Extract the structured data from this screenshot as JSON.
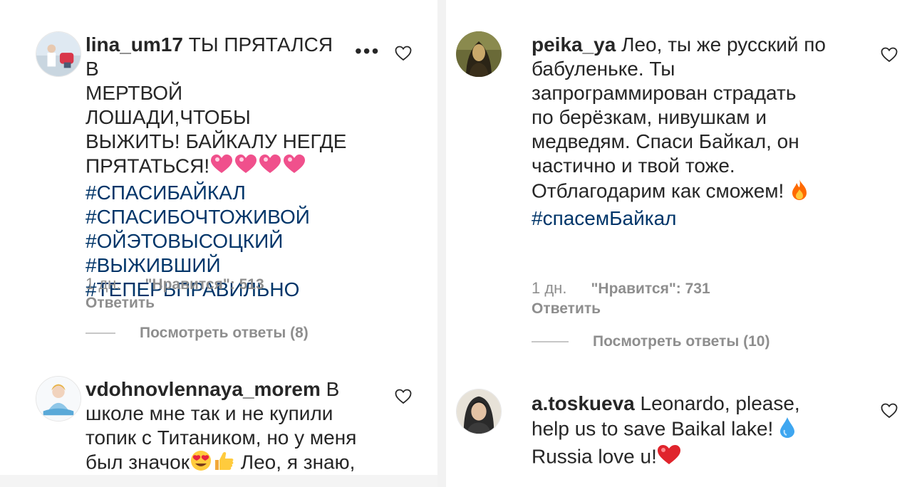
{
  "comments": [
    {
      "username": "lina_um17",
      "lines": [
        "ТЫ ПРЯТАЛСЯ В",
        "МЕРТВОЙ ЛОШАДИ,ЧТОБЫ",
        "ВЫЖИТЬ! БАЙКАЛУ НЕГДЕ",
        "ПРЯТАТЬСЯ!"
      ],
      "hashtags": [
        "#СПАСИБАЙКАЛ",
        "#СПАСИБОЧТОЖИВОЙ",
        "#ОЙЭТОВЫСОЦКИЙ",
        "#ВЫЖИВШИЙ",
        "#ТЕПЕРЬПРАВИЛЬНО"
      ],
      "time": "1 дн.",
      "likes": "\"Нравится\": 513",
      "reply": "Ответить",
      "view_replies": "Посмотреть ответы (8)",
      "more_icon": "more-dots-icon",
      "emojis": [
        "pink-hearts-icon"
      ]
    },
    {
      "username": "vdohnovlennaya_morem",
      "lines": [
        "В",
        "школе мне так и не купили",
        "топик с Титаником, но у меня",
        "был значок",
        "Лео, я знаю,"
      ],
      "emojis": [
        "heart-eyes-icon",
        "thumbs-up-icon"
      ]
    },
    {
      "username": "peika_ya",
      "lines": [
        "Лео, ты же русский по",
        "бабуленьке. Ты",
        "запрограммирован страдать",
        "по берёзкам, нивушкам и",
        "медведям. Спаси Байкал, он",
        "частично и твой тоже.",
        "Отблагодарим как сможем!"
      ],
      "hashtags": [
        "#спасемБайкал"
      ],
      "time": "1 дн.",
      "likes": "\"Нравится\": 731",
      "reply": "Ответить",
      "view_replies": "Посмотреть ответы (10)",
      "emojis": [
        "fire-icon"
      ]
    },
    {
      "username": "a.toskueva",
      "lines": [
        "Leonardo, please,",
        "help us to save Baikal lake!",
        "Russia love u!"
      ],
      "emojis": [
        "droplet-icon",
        "red-heart-icon"
      ]
    }
  ],
  "colors": {
    "text": "#262626",
    "hashtag": "#003569",
    "meta": "#8e8e8e",
    "heart_outline": "#262626",
    "pink_heart": "#f0508c",
    "fire": "#ff6a00",
    "droplet": "#3ea6f0",
    "red_heart": "#e0242c"
  }
}
